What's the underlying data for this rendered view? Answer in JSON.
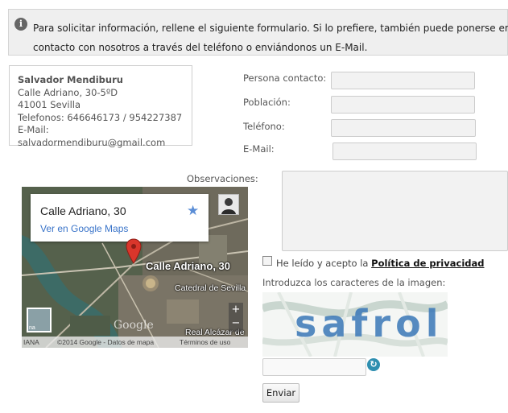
{
  "info": {
    "line1": "Para solicitar información, rellene el siguiente formulario. Si lo prefiere, también puede ponerse en",
    "line2": "contacto con nosotros a través del teléfono o enviándonos un E-Mail."
  },
  "address": {
    "name": "Salvador Mendiburu",
    "street": "Calle Adriano, 30-5ºD",
    "city": "41001 Sevilla",
    "phones": "Telefonos: 646646173 / 954227387",
    "email": "E-Mail: salvadormendiburu@gmail.com"
  },
  "form": {
    "contact_label": "Persona contacto:",
    "city_label": "Población:",
    "phone_label": "Teléfono:",
    "email_label": "E-Mail:",
    "observations_label": "Observaciones:",
    "privacy_prefix": "He leído y acepto la",
    "privacy_link": "Política de privacidad",
    "captcha_label": "Introduzca los caracteres de la imagen:",
    "captcha_text": "safrol",
    "submit_label": "Enviar"
  },
  "map": {
    "card_title": "Calle Adriano, 30",
    "card_link": "Ver en Google Maps",
    "marker_label": "Calle Adriano, 30",
    "city_label": "Catedral de Sevilla",
    "street_label": "Real Alcázar de",
    "layer_caption": "na",
    "google_mark": "Google",
    "footer_left": "IANA",
    "footer_copy": "©2014 Google - Datos de mapa",
    "footer_terms": "Términos de uso",
    "zoom_in": "+",
    "zoom_out": "−"
  },
  "icons": {
    "info": "info-icon",
    "star": "star-icon",
    "refresh": "refresh-icon",
    "marker": "map-marker-icon"
  },
  "colors": {
    "banner_bg": "#efefef",
    "link_blue": "#3a74c9",
    "marker_red": "#d9362b"
  }
}
